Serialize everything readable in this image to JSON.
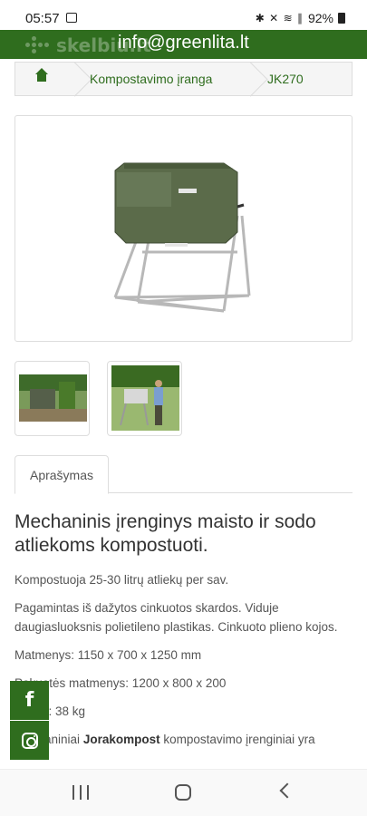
{
  "status_bar": {
    "time": "05:57",
    "icons": "✱ ✕ ≋ ∥",
    "battery": "92%"
  },
  "header": {
    "logo_text": "skelbiu.lt",
    "email": "info@greenlita.lt",
    "brand_color": "#2f6d1e"
  },
  "breadcrumb": {
    "home_icon": "home-icon",
    "category": "Kompostavimo įranga",
    "current": "JK270"
  },
  "tabs": [
    {
      "label": "Aprašymas"
    }
  ],
  "description": {
    "headline": "Mechaninis įrenginys maisto ir sodo atliekoms kompostuoti.",
    "p1": "Kompostuoja 25-30 litrų atliekų per sav.",
    "p2": "Pagamintas iš dažytos cinkuotos skardos. Viduje daugiasluoksnis polietileno plastikas. Cinkuoto plieno kojos.",
    "p3": "Matmenys: 1150 x 700 x 1250 mm",
    "p4": "Pakuotės matmenys: 1200 x 800 x 200",
    "p5": "Svoris: 38 kg",
    "p6_bold": "Jorakompost",
    "p6_pre": "Mechaniniai",
    "p6_post": "kompostavimo įrenginiai yra"
  },
  "social": {
    "facebook_label": "f"
  }
}
